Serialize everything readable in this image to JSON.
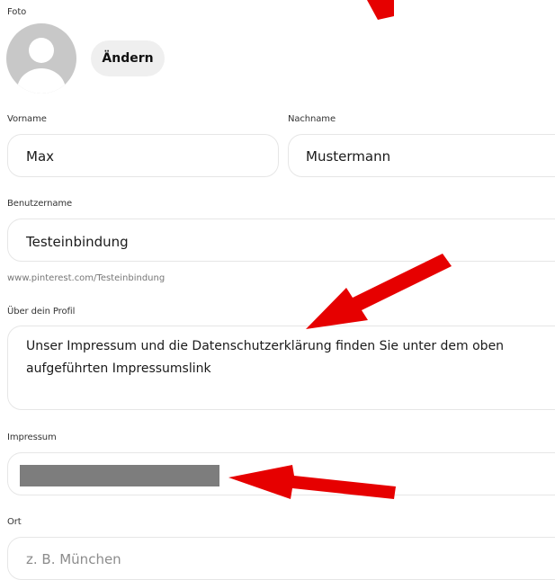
{
  "photo": {
    "label": "Foto",
    "change_label": "Ändern",
    "icon": "user-silhouette-icon"
  },
  "first_name": {
    "label": "Vorname",
    "value": "Max"
  },
  "last_name": {
    "label": "Nachname",
    "value": "Mustermann"
  },
  "username": {
    "label": "Benutzername",
    "value": "Testeinbindung",
    "url_hint": "www.pinterest.com/Testeinbindung"
  },
  "about": {
    "label": "Über dein Profil",
    "value": "Unser Impressum und die Datenschutzerklärung finden Sie unter dem oben aufgeführten Impressumslink"
  },
  "imprint": {
    "label": "Impressum",
    "value_redacted": true,
    "redaction_color": "#7d7d7d"
  },
  "location": {
    "label": "Ort",
    "placeholder": "z. B. München"
  },
  "annotation_color": "#e60000"
}
